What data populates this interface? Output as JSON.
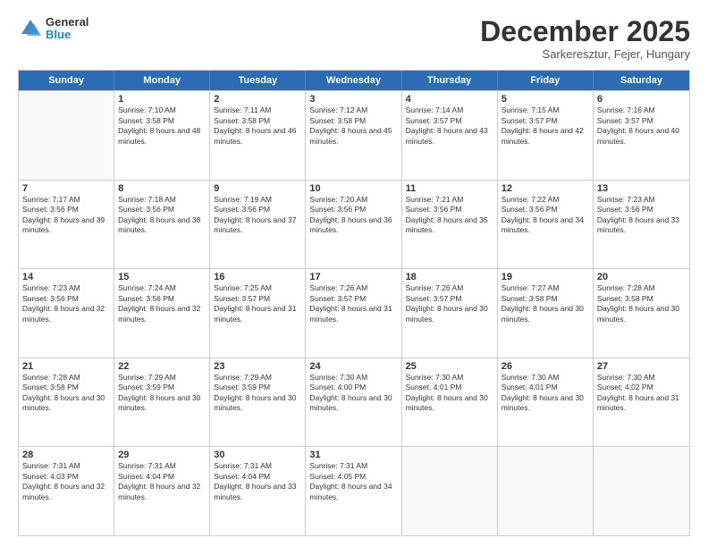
{
  "logo": {
    "general": "General",
    "blue": "Blue"
  },
  "header": {
    "month": "December 2025",
    "location": "Sarkeresztur, Fejer, Hungary"
  },
  "days": [
    "Sunday",
    "Monday",
    "Tuesday",
    "Wednesday",
    "Thursday",
    "Friday",
    "Saturday"
  ],
  "weeks": [
    [
      {
        "day": "",
        "sunrise": "",
        "sunset": "",
        "daylight": ""
      },
      {
        "day": "1",
        "sunrise": "Sunrise: 7:10 AM",
        "sunset": "Sunset: 3:58 PM",
        "daylight": "Daylight: 8 hours and 48 minutes."
      },
      {
        "day": "2",
        "sunrise": "Sunrise: 7:11 AM",
        "sunset": "Sunset: 3:58 PM",
        "daylight": "Daylight: 8 hours and 46 minutes."
      },
      {
        "day": "3",
        "sunrise": "Sunrise: 7:12 AM",
        "sunset": "Sunset: 3:58 PM",
        "daylight": "Daylight: 8 hours and 45 minutes."
      },
      {
        "day": "4",
        "sunrise": "Sunrise: 7:14 AM",
        "sunset": "Sunset: 3:57 PM",
        "daylight": "Daylight: 8 hours and 43 minutes."
      },
      {
        "day": "5",
        "sunrise": "Sunrise: 7:15 AM",
        "sunset": "Sunset: 3:57 PM",
        "daylight": "Daylight: 8 hours and 42 minutes."
      },
      {
        "day": "6",
        "sunrise": "Sunrise: 7:16 AM",
        "sunset": "Sunset: 3:57 PM",
        "daylight": "Daylight: 8 hours and 40 minutes."
      }
    ],
    [
      {
        "day": "7",
        "sunrise": "Sunrise: 7:17 AM",
        "sunset": "Sunset: 3:56 PM",
        "daylight": "Daylight: 8 hours and 39 minutes."
      },
      {
        "day": "8",
        "sunrise": "Sunrise: 7:18 AM",
        "sunset": "Sunset: 3:56 PM",
        "daylight": "Daylight: 8 hours and 38 minutes."
      },
      {
        "day": "9",
        "sunrise": "Sunrise: 7:19 AM",
        "sunset": "Sunset: 3:56 PM",
        "daylight": "Daylight: 8 hours and 37 minutes."
      },
      {
        "day": "10",
        "sunrise": "Sunrise: 7:20 AM",
        "sunset": "Sunset: 3:56 PM",
        "daylight": "Daylight: 8 hours and 36 minutes."
      },
      {
        "day": "11",
        "sunrise": "Sunrise: 7:21 AM",
        "sunset": "Sunset: 3:56 PM",
        "daylight": "Daylight: 8 hours and 35 minutes."
      },
      {
        "day": "12",
        "sunrise": "Sunrise: 7:22 AM",
        "sunset": "Sunset: 3:56 PM",
        "daylight": "Daylight: 8 hours and 34 minutes."
      },
      {
        "day": "13",
        "sunrise": "Sunrise: 7:23 AM",
        "sunset": "Sunset: 3:56 PM",
        "daylight": "Daylight: 8 hours and 33 minutes."
      }
    ],
    [
      {
        "day": "14",
        "sunrise": "Sunrise: 7:23 AM",
        "sunset": "Sunset: 3:56 PM",
        "daylight": "Daylight: 8 hours and 32 minutes."
      },
      {
        "day": "15",
        "sunrise": "Sunrise: 7:24 AM",
        "sunset": "Sunset: 3:56 PM",
        "daylight": "Daylight: 8 hours and 32 minutes."
      },
      {
        "day": "16",
        "sunrise": "Sunrise: 7:25 AM",
        "sunset": "Sunset: 3:57 PM",
        "daylight": "Daylight: 8 hours and 31 minutes."
      },
      {
        "day": "17",
        "sunrise": "Sunrise: 7:26 AM",
        "sunset": "Sunset: 3:57 PM",
        "daylight": "Daylight: 8 hours and 31 minutes."
      },
      {
        "day": "18",
        "sunrise": "Sunrise: 7:26 AM",
        "sunset": "Sunset: 3:57 PM",
        "daylight": "Daylight: 8 hours and 30 minutes."
      },
      {
        "day": "19",
        "sunrise": "Sunrise: 7:27 AM",
        "sunset": "Sunset: 3:58 PM",
        "daylight": "Daylight: 8 hours and 30 minutes."
      },
      {
        "day": "20",
        "sunrise": "Sunrise: 7:28 AM",
        "sunset": "Sunset: 3:58 PM",
        "daylight": "Daylight: 8 hours and 30 minutes."
      }
    ],
    [
      {
        "day": "21",
        "sunrise": "Sunrise: 7:28 AM",
        "sunset": "Sunset: 3:58 PM",
        "daylight": "Daylight: 8 hours and 30 minutes."
      },
      {
        "day": "22",
        "sunrise": "Sunrise: 7:29 AM",
        "sunset": "Sunset: 3:59 PM",
        "daylight": "Daylight: 8 hours and 30 minutes."
      },
      {
        "day": "23",
        "sunrise": "Sunrise: 7:29 AM",
        "sunset": "Sunset: 3:59 PM",
        "daylight": "Daylight: 8 hours and 30 minutes."
      },
      {
        "day": "24",
        "sunrise": "Sunrise: 7:30 AM",
        "sunset": "Sunset: 4:00 PM",
        "daylight": "Daylight: 8 hours and 30 minutes."
      },
      {
        "day": "25",
        "sunrise": "Sunrise: 7:30 AM",
        "sunset": "Sunset: 4:01 PM",
        "daylight": "Daylight: 8 hours and 30 minutes."
      },
      {
        "day": "26",
        "sunrise": "Sunrise: 7:30 AM",
        "sunset": "Sunset: 4:01 PM",
        "daylight": "Daylight: 8 hours and 30 minutes."
      },
      {
        "day": "27",
        "sunrise": "Sunrise: 7:30 AM",
        "sunset": "Sunset: 4:02 PM",
        "daylight": "Daylight: 8 hours and 31 minutes."
      }
    ],
    [
      {
        "day": "28",
        "sunrise": "Sunrise: 7:31 AM",
        "sunset": "Sunset: 4:03 PM",
        "daylight": "Daylight: 8 hours and 32 minutes."
      },
      {
        "day": "29",
        "sunrise": "Sunrise: 7:31 AM",
        "sunset": "Sunset: 4:04 PM",
        "daylight": "Daylight: 8 hours and 32 minutes."
      },
      {
        "day": "30",
        "sunrise": "Sunrise: 7:31 AM",
        "sunset": "Sunset: 4:04 PM",
        "daylight": "Daylight: 8 hours and 33 minutes."
      },
      {
        "day": "31",
        "sunrise": "Sunrise: 7:31 AM",
        "sunset": "Sunset: 4:05 PM",
        "daylight": "Daylight: 8 hours and 34 minutes."
      },
      {
        "day": "",
        "sunrise": "",
        "sunset": "",
        "daylight": ""
      },
      {
        "day": "",
        "sunrise": "",
        "sunset": "",
        "daylight": ""
      },
      {
        "day": "",
        "sunrise": "",
        "sunset": "",
        "daylight": ""
      }
    ]
  ]
}
